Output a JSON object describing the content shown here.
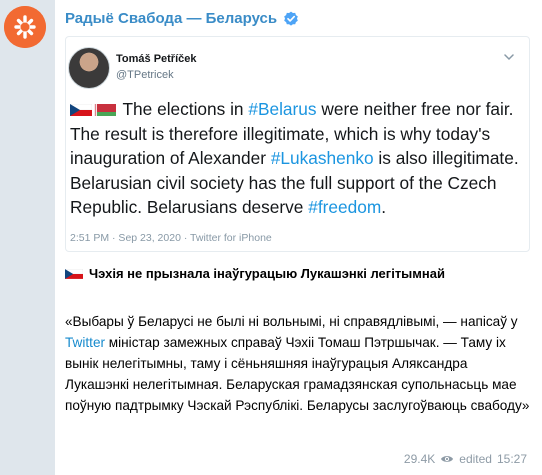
{
  "channel": {
    "name": "Радыё Свабода — Беларусь",
    "logo_color": "#f26a32",
    "accent_color": "#3a8cc7",
    "verified_icon": "verified-badge-icon"
  },
  "tweet": {
    "author_name": "Tomáš Petříček",
    "author_handle": "@TPetricek",
    "text_parts": {
      "p1": "The elections in ",
      "p2": "#Belarus",
      "p3": " were neither free nor fair. The result is therefore illegitimate, which is why today's inauguration of Alexander ",
      "p4": "#Lukashenko",
      "p5": " is also illegitimate. Belarusian civil society has the full support of the Czech Republic. Belarusians deserve ",
      "p6": "#freedom",
      "p7": "."
    },
    "meta": "2:51 PM · Sep 23, 2020 · Twitter for iPhone",
    "hashtag_color": "#1b95e0"
  },
  "caption": "Чэхія не прызнала інаўгурацыю Лукашэнкі легітымнай",
  "body": {
    "t1": "«Выбары ў Беларусі не былі ні вольнымі, ні справядлівымі, — напісаў у ",
    "link": "Twitter",
    "t2": " міністар замежных справаў Чэхіі Томаш Пэтршычак. — Таму іх вынік нелегітымны, таму і сёньняшняя інаўгурацыя Аляксандра Лукашэнкі нелегітымная. Беларуская грамадзянская супольнасьць мае поўную падтрымку Чэскай Рэспублікі. Беларусы заслугоўваюць свабоду»"
  },
  "footer": {
    "views": "29.4K",
    "edited": "edited",
    "time": "15:27"
  }
}
